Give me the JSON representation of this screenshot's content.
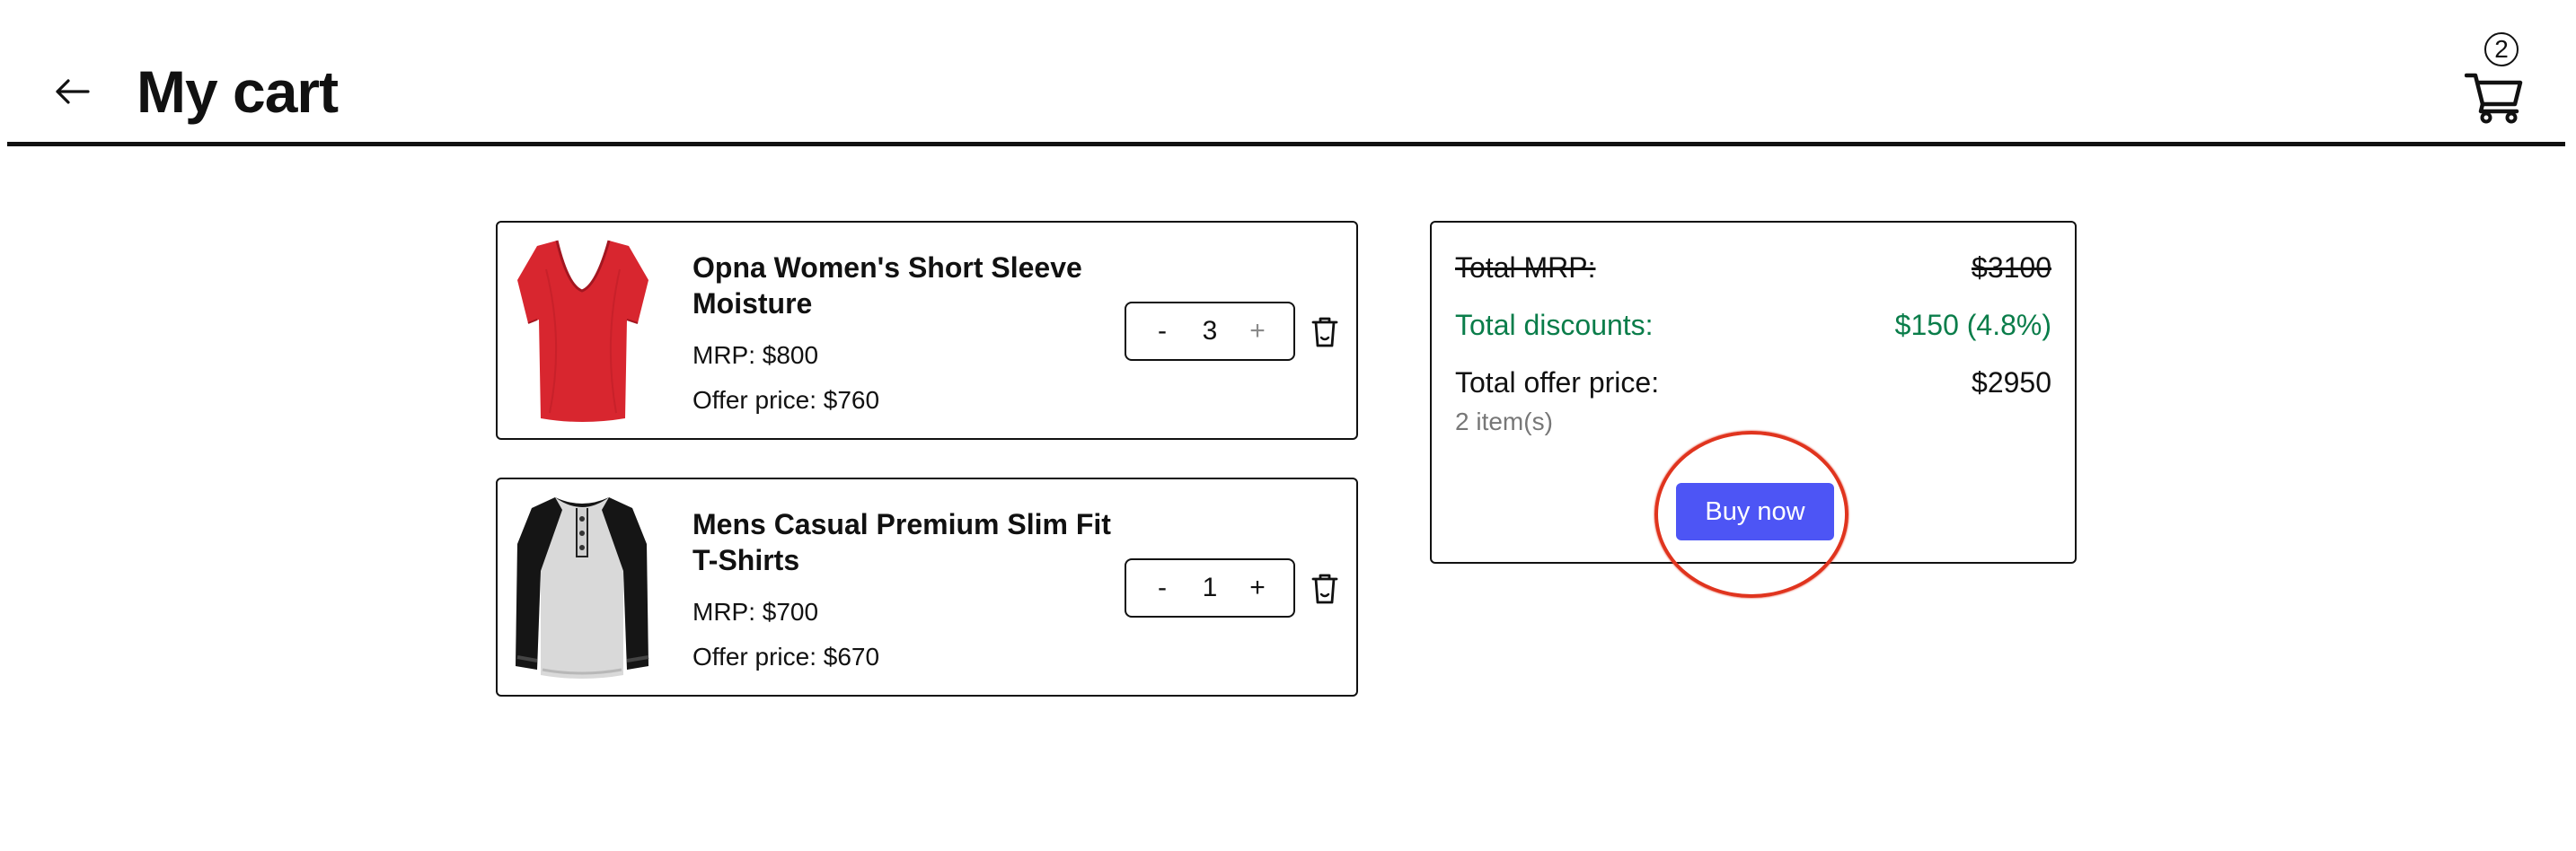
{
  "header": {
    "title": "My cart",
    "back_icon": "arrow-left-icon",
    "cart_icon": "shopping-cart-icon",
    "cart_count": "2"
  },
  "cart": {
    "items": [
      {
        "name": "Opna Women's Short Sleeve Moisture",
        "mrp": "MRP: $800",
        "offer_price": "Offer price: $760",
        "quantity": "3",
        "decrement_label": "-",
        "increment_label": "+",
        "increment_disabled": true,
        "image": "red-v-neck-tshirt",
        "delete_icon": "trash-icon"
      },
      {
        "name": "Mens Casual Premium Slim Fit T-Shirts",
        "mrp": "MRP: $700",
        "offer_price": "Offer price: $670",
        "quantity": "1",
        "decrement_label": "-",
        "increment_label": "+",
        "increment_disabled": false,
        "image": "raglan-henley-tshirt",
        "delete_icon": "trash-icon"
      }
    ]
  },
  "summary": {
    "total_mrp_label": "Total MRP:",
    "total_mrp_value": "$3100",
    "total_discounts_label": "Total discounts:",
    "total_discounts_value": "$150 (4.8%)",
    "total_offer_label": "Total offer price:",
    "total_offer_value": "$2950",
    "items_count": "2 item(s)",
    "buy_label": "Buy now"
  },
  "colors": {
    "discount_green": "#0a7d4a",
    "buy_button": "#4d55f5",
    "highlight_circle": "#e0341e"
  }
}
